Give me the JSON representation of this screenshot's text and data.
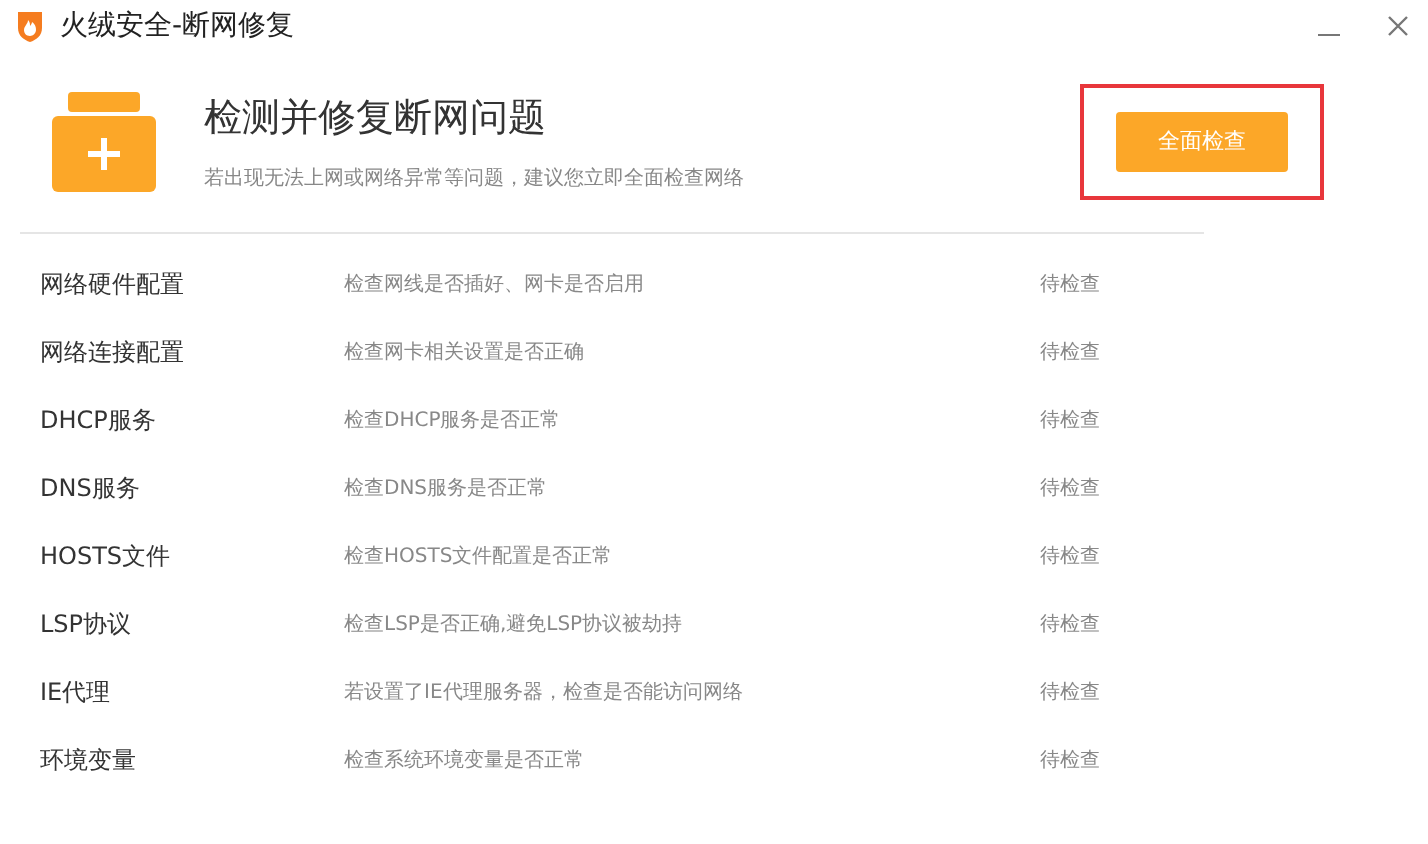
{
  "window": {
    "title": "火绒安全-断网修复"
  },
  "header": {
    "title": "检测并修复断网问题",
    "subtitle": "若出现无法上网或网络异常等问题，建议您立即全面检查网络"
  },
  "scan_button": {
    "label": "全面检查",
    "highlighted": true
  },
  "checks": [
    {
      "name": "网络硬件配置",
      "description": "检查网线是否插好、网卡是否启用",
      "status": "待检查"
    },
    {
      "name": "网络连接配置",
      "description": "检查网卡相关设置是否正确",
      "status": "待检查"
    },
    {
      "name": "DHCP服务",
      "description": "检查DHCP服务是否正常",
      "status": "待检查"
    },
    {
      "name": "DNS服务",
      "description": "检查DNS服务是否正常",
      "status": "待检查"
    },
    {
      "name": "HOSTS文件",
      "description": "检查HOSTS文件配置是否正常",
      "status": "待检查"
    },
    {
      "name": "LSP协议",
      "description": "检查LSP是否正确,避免LSP协议被劫持",
      "status": "待检查"
    },
    {
      "name": "IE代理",
      "description": "若设置了IE代理服务器，检查是否能访问网络",
      "status": "待检查"
    },
    {
      "name": "环境变量",
      "description": "检查系统环境变量是否正常",
      "status": "待检查"
    }
  ]
}
